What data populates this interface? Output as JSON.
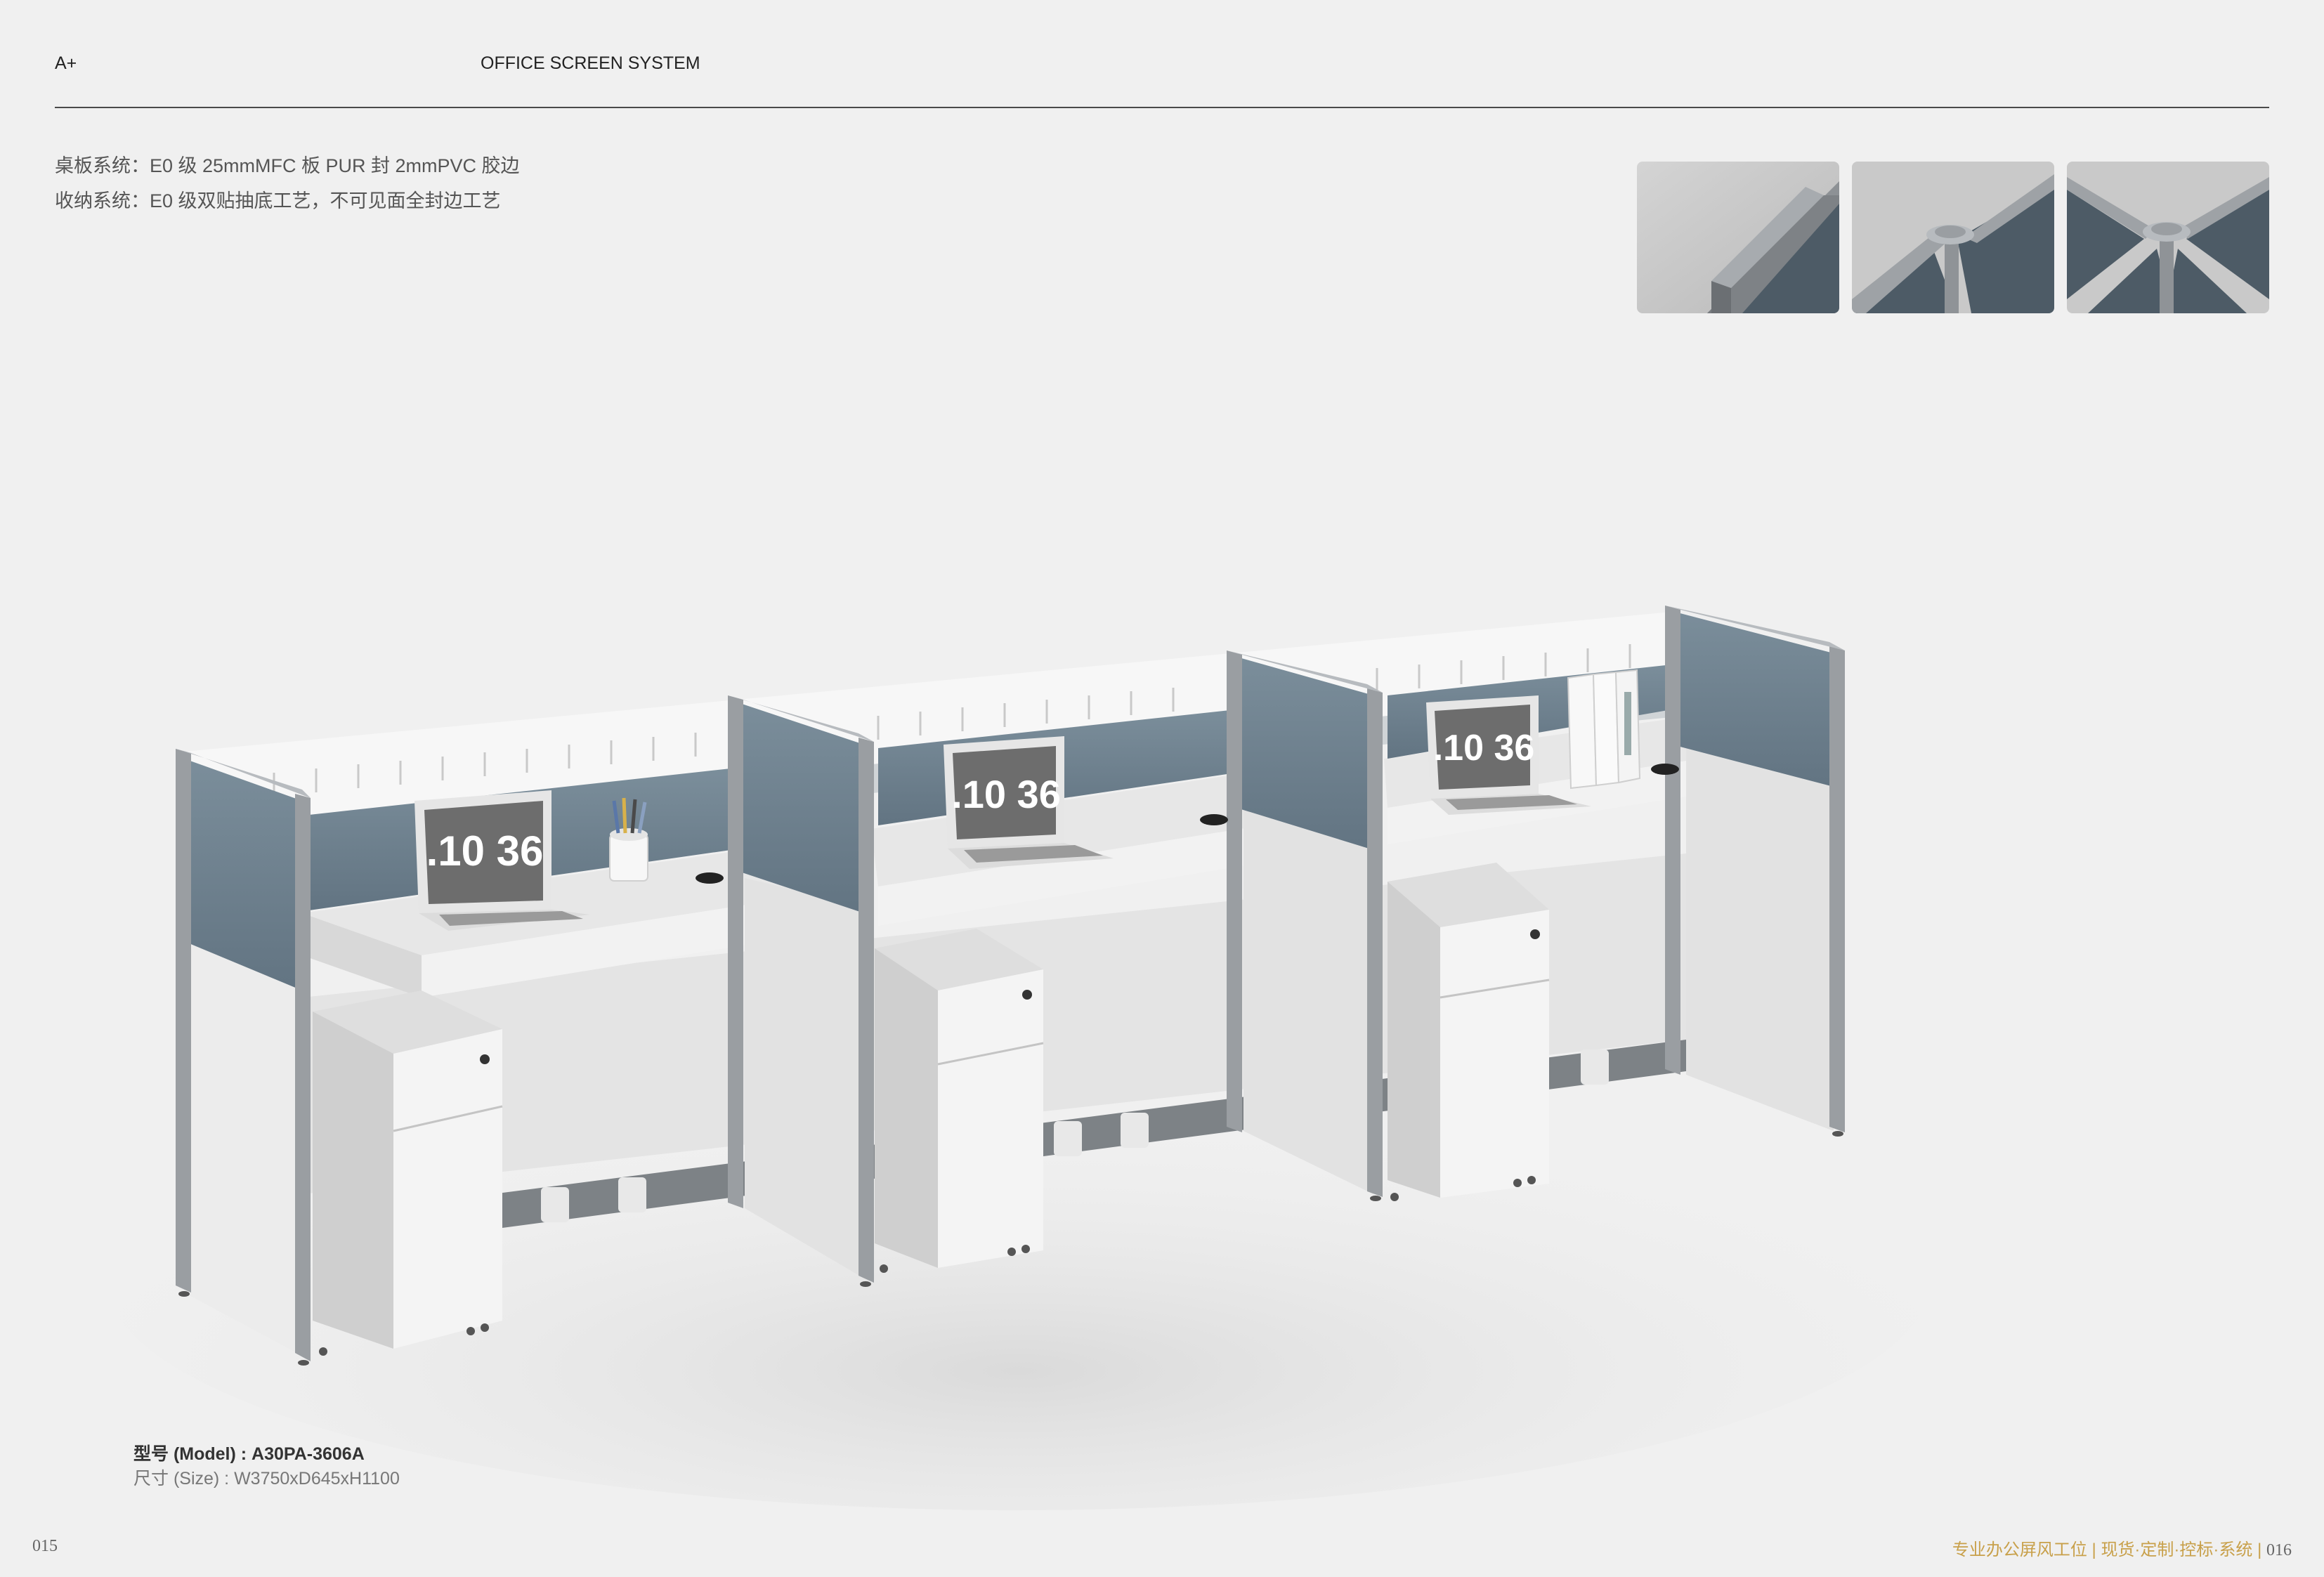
{
  "header": {
    "brand": "A+",
    "series": "OFFICE SCREEN SYSTEM"
  },
  "specs": {
    "line1": "桌板系统：E0 级 25mmMFC 板 PUR 封 2mmPVC 胶边",
    "line2": "收纳系统：E0 级双贴抽底工艺，不可见面全封边工艺"
  },
  "laptop_screen_text": [
    ".10 36",
    ".10 36",
    ".10 36"
  ],
  "product": {
    "model": "型号 (Model) : A30PA-3606A",
    "size": "尺寸 (Size) : W3750xD645xH1100"
  },
  "footer": {
    "page_left": "015",
    "tagline": "专业办公屏风工位",
    "tags": "现货·定制·控标·系统",
    "page_right": "016"
  },
  "colors": {
    "background": "#f0f0f0",
    "panel_fabric": "#6f8391",
    "frame": "#9a9ea2",
    "desk_white": "#e9e9e9",
    "accent": "#c8a04a"
  }
}
